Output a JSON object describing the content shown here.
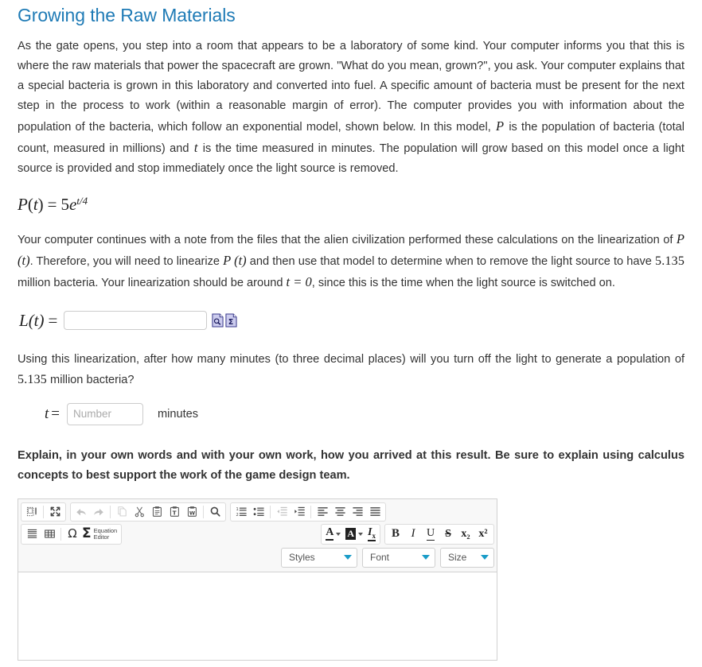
{
  "page": {
    "title": "Growing the Raw Materials",
    "title_color": "#1f7bb6",
    "paragraph1": "As the gate opens, you step into a room that appears to be a laboratory of some kind. Your computer informs you that this is where the raw materials that power the spacecraft are grown. \"What do you mean, grown?\", you ask. Your computer explains that a special bacteria is grown in this laboratory and converted into fuel. A specific amount of bacteria must be present for the next step in the process to work (within a reasonable margin of error). The computer provides you with information about the population of the bacteria, which follow an exponential model, shown below. In this model, ",
    "paragraph1_var_P": "P",
    "paragraph1_mid": " is the population of bacteria (total count, measured in millions) and ",
    "paragraph1_var_t": "t",
    "paragraph1_end": " is the time measured in minutes. The population will grow based on this model once a light source is provided and stop immediately once the light source is removed.",
    "equation": {
      "fn": "P",
      "arg": "t",
      "equals": "=",
      "coefficient": "5",
      "base": "e",
      "exponent": "t/4",
      "plain": "P(t) = 5e^(t/4)"
    },
    "paragraph2_a": "Your computer continues with a note from the files that the alien civilization performed these calculations on the linearization of ",
    "paragraph2_P1": "P (t)",
    "paragraph2_b": ". Therefore, you will need to linearize ",
    "paragraph2_P2": "P (t)",
    "paragraph2_c": " and then use that model to determine when to remove the light source to have ",
    "paragraph2_value": "5.135",
    "paragraph2_d": " million bacteria. Your linearization should be around ",
    "paragraph2_teq": "t = 0",
    "paragraph2_e": ", since this is the time when the light source is switched on.",
    "answer_label": {
      "fn": "L",
      "arg": "(t)",
      "equals": "="
    },
    "lt_input": {
      "value": "",
      "placeholder": ""
    },
    "icon_buttons": [
      {
        "name": "preview-answer-icon",
        "glyph": "magnifier"
      },
      {
        "name": "equation-editor-icon",
        "glyph": "sigma"
      }
    ],
    "paragraph3_a": "Using this linearization, after how many minutes (to three decimal places) will you turn off the light to generate a population of ",
    "paragraph3_value": "5.135",
    "paragraph3_b": " million bacteria?",
    "t_label": {
      "var": "t",
      "equals": "="
    },
    "t_input": {
      "value": "",
      "placeholder": "Number"
    },
    "minutes_label": "minutes",
    "explain_text": "Explain, in your own words and with your own work, how you arrived at this result. Be sure to explain using calculus concepts to best support the work of the game design team."
  },
  "editor": {
    "toolbar_row1": [
      {
        "group": 1,
        "name": "source-icon",
        "label": "Source",
        "disabled": false
      },
      {
        "group": 1,
        "name": "maximize-icon",
        "label": "Maximize",
        "disabled": false
      },
      {
        "group": 2,
        "name": "undo-icon",
        "label": "Undo",
        "disabled": true
      },
      {
        "group": 2,
        "name": "redo-icon",
        "label": "Redo",
        "disabled": true
      },
      {
        "group": 2,
        "name": "copy-icon",
        "label": "Copy",
        "disabled": true
      },
      {
        "group": 2,
        "name": "cut-icon",
        "label": "Cut",
        "disabled": false
      },
      {
        "group": 2,
        "name": "paste-icon",
        "label": "Paste",
        "disabled": false
      },
      {
        "group": 2,
        "name": "paste-as-text-icon",
        "label": "Paste as plain text",
        "disabled": false
      },
      {
        "group": 2,
        "name": "paste-from-word-icon",
        "label": "Paste from Word",
        "disabled": false
      },
      {
        "group": 2,
        "name": "find-icon",
        "label": "Find",
        "disabled": false
      },
      {
        "group": 3,
        "name": "numbered-list-icon",
        "label": "Insert/Remove Numbered List",
        "disabled": false
      },
      {
        "group": 3,
        "name": "bulleted-list-icon",
        "label": "Insert/Remove Bulleted List",
        "disabled": false
      },
      {
        "group": 3,
        "name": "decrease-indent-icon",
        "label": "Decrease Indent",
        "disabled": true
      },
      {
        "group": 3,
        "name": "increase-indent-icon",
        "label": "Increase Indent",
        "disabled": false
      },
      {
        "group": 3,
        "name": "align-left-icon",
        "label": "Align Left",
        "disabled": false
      },
      {
        "group": 3,
        "name": "align-center-icon",
        "label": "Center",
        "disabled": false
      },
      {
        "group": 3,
        "name": "align-right-icon",
        "label": "Align Right",
        "disabled": false
      },
      {
        "group": 3,
        "name": "justify-icon",
        "label": "Justify",
        "disabled": false
      }
    ],
    "toolbar_row2_left": [
      {
        "name": "horizontal-rule-icon",
        "label": "Insert Horizontal Line"
      },
      {
        "name": "table-icon",
        "label": "Table"
      },
      {
        "name": "special-character-icon",
        "label": "Insert Special Character",
        "glyph": "Ω"
      },
      {
        "name": "equation-editor-button",
        "label": "Equation Editor",
        "glyph": "Σ",
        "text_line1": "Equation",
        "text_line2": "Editor"
      }
    ],
    "toolbar_row2_right": [
      {
        "name": "text-color-icon",
        "label": "Text Color",
        "glyph": "A"
      },
      {
        "name": "background-color-icon",
        "label": "Background Color",
        "glyph": "A"
      },
      {
        "name": "remove-format-icon",
        "label": "Remove Format",
        "glyph": "Ix"
      },
      {
        "name": "bold-icon",
        "label": "B"
      },
      {
        "name": "italic-icon",
        "label": "I"
      },
      {
        "name": "underline-icon",
        "label": "U"
      },
      {
        "name": "strikethrough-icon",
        "label": "S"
      },
      {
        "name": "subscript-icon",
        "label": "x₂"
      },
      {
        "name": "superscript-icon",
        "label": "x²"
      }
    ],
    "combos": [
      {
        "name": "styles-combo",
        "label": "Styles"
      },
      {
        "name": "font-combo",
        "label": "Font"
      },
      {
        "name": "size-combo",
        "label": "Size"
      }
    ],
    "body_content": "",
    "accent_caret_color": "#1a9cc8"
  }
}
